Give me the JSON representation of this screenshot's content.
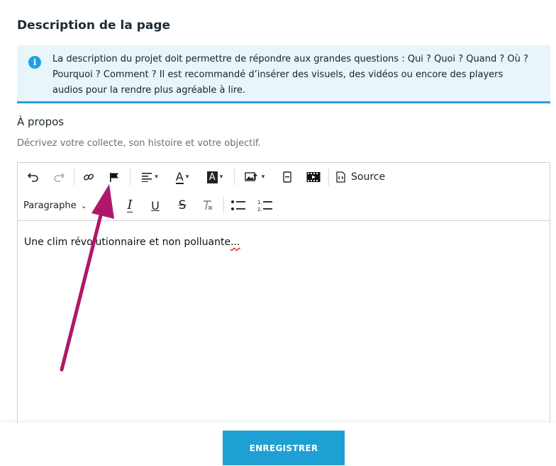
{
  "page": {
    "title": "Description de la page"
  },
  "info": {
    "icon": "info-icon",
    "text": "La description du projet doit permettre de répondre aux grandes questions : Qui ? Quoi ? Quand ? Où ? Pourquoi ? Comment ? Il est recommandé d’insérer des visuels, des vidéos ou encore des players audios pour la rendre plus agréable à lire."
  },
  "about": {
    "label": "À propos",
    "help": "Décrivez votre collecte, son histoire et votre objectif."
  },
  "toolbar": {
    "source_label": "Source",
    "paragraph_label": "Paragraphe"
  },
  "editor": {
    "content_main": "Une clim révolutionnaire et non polluante",
    "content_tail": "..."
  },
  "footer": {
    "save_label": "ENREGISTRER"
  },
  "colors": {
    "accent": "#1ea0d4",
    "info_bg": "#e8f5fb",
    "annotation_arrow": "#b0176a"
  }
}
